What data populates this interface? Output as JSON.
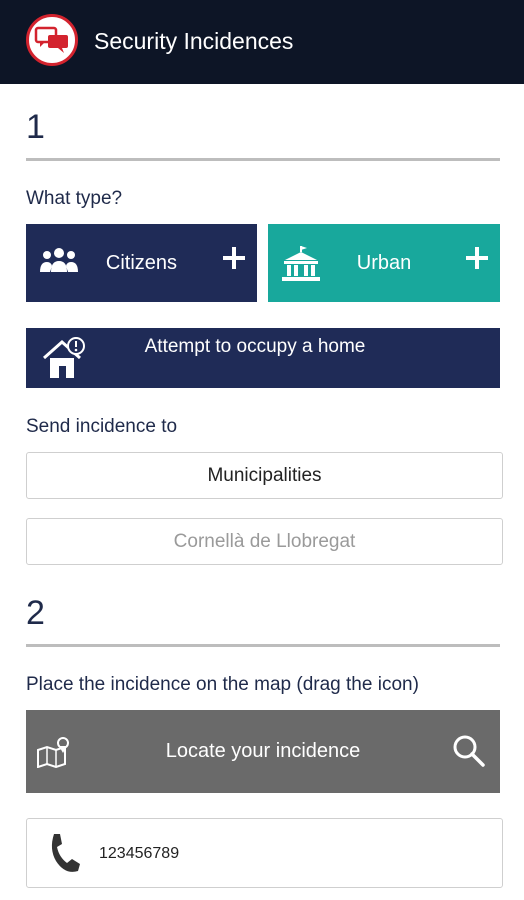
{
  "header": {
    "title": "Security Incidences",
    "logo_icon": "chat-bubbles-icon",
    "accent": "#d3232e",
    "background": "#0d1526"
  },
  "step1": {
    "number": "1",
    "type_label": "What type?",
    "citizens": {
      "label": "Citizens",
      "icon": "people-group-icon",
      "color": "#1f2b57"
    },
    "urban": {
      "label": "Urban",
      "icon": "building-icon",
      "color": "#18a89c"
    },
    "occupy": {
      "label": "Attempt to occupy a home",
      "icon": "house-alert-icon"
    },
    "send_label": "Send incidence to",
    "municipalities": "Municipalities",
    "city_placeholder": "Cornellà de Llobregat"
  },
  "step2": {
    "number": "2",
    "map_label": "Place the incidence on the map (drag the icon)",
    "locate_label": "Locate your incidence",
    "phone": "123456789"
  }
}
